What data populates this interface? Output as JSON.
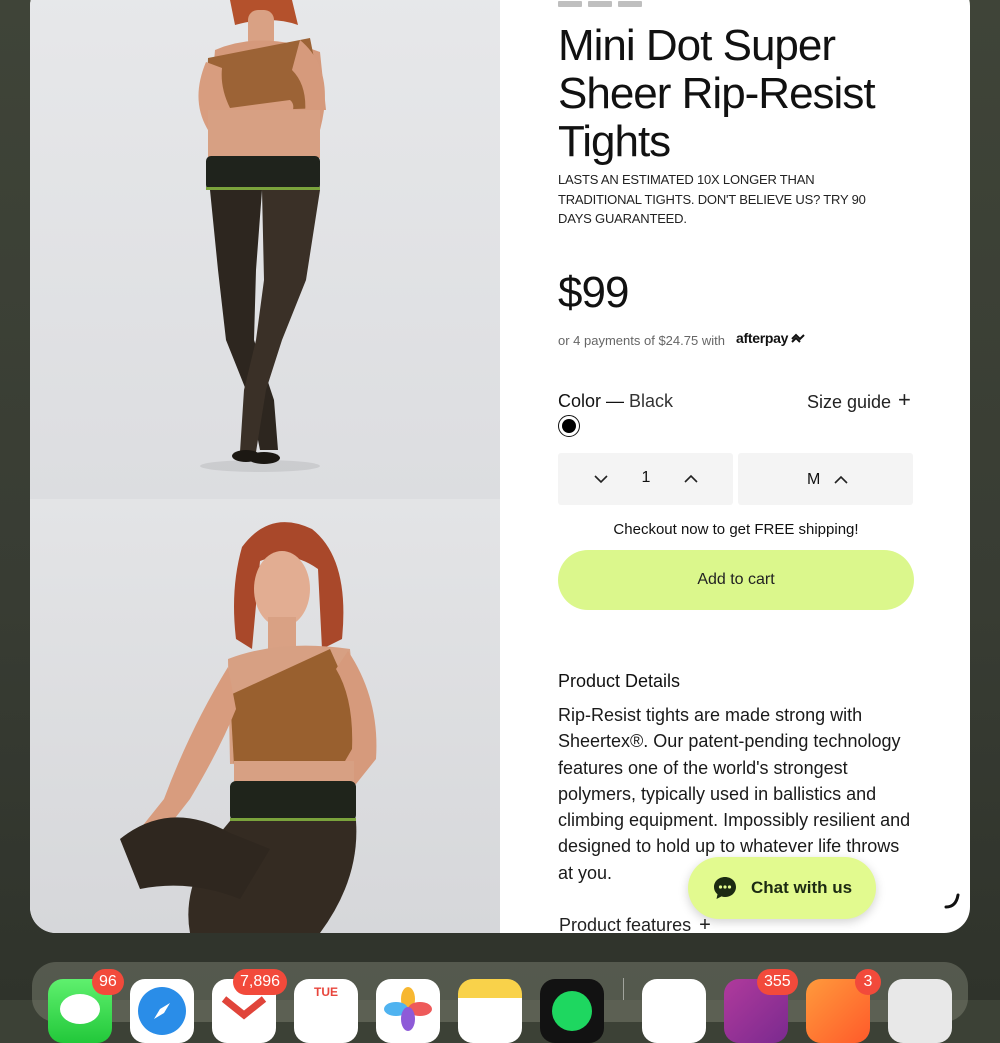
{
  "product": {
    "title": "Mini Dot Super Sheer Rip-Resist Tights",
    "tagline": "LASTS AN ESTIMATED 10X LONGER THAN TRADITIONAL TIGHTS. DON'T BELIEVE US? TRY 90 DAYS GUARANTEED.",
    "price": "$99",
    "installments": "or 4 payments of $24.75 with",
    "afterpay_brand": "afterpay",
    "color_label": "Color —",
    "color_value": "Black",
    "size_guide_label": "Size guide",
    "size_guide_plus": "+",
    "quantity": "1",
    "size": "M",
    "shipping_note": "Checkout now to get FREE shipping!",
    "add_to_cart_label": "Add to cart",
    "details_heading": "Product Details",
    "details_text": "Rip-Resist tights are made strong with Sheertex®. Our patent-pending technology features one of the world's strongest polymers, typically used in ballistics and climbing equipment. Impossibly resilient and designed to hold up to whatever life throws at you.",
    "features_label": "Product features",
    "features_plus": "+",
    "swatch_color": "#000000"
  },
  "chat": {
    "label": "Chat with us"
  },
  "colors": {
    "accent": "#dbf78c",
    "chat_bg": "#e2fa8f",
    "badge": "#f24a3b"
  },
  "dock": {
    "apps": [
      {
        "name": "messages-icon",
        "badge": "96"
      },
      {
        "name": "safari-icon",
        "badge": ""
      },
      {
        "name": "gmail-icon",
        "badge": "7,896"
      },
      {
        "name": "calendar-icon",
        "badge": "",
        "label": "TUE"
      },
      {
        "name": "photos-icon",
        "badge": ""
      },
      {
        "name": "notes-icon",
        "badge": ""
      },
      {
        "name": "spotify-icon",
        "badge": ""
      },
      {
        "name": "app-icon",
        "badge": ""
      },
      {
        "name": "app-icon",
        "badge": "355"
      },
      {
        "name": "app-icon",
        "badge": "3"
      },
      {
        "name": "app-icon",
        "badge": ""
      }
    ]
  }
}
